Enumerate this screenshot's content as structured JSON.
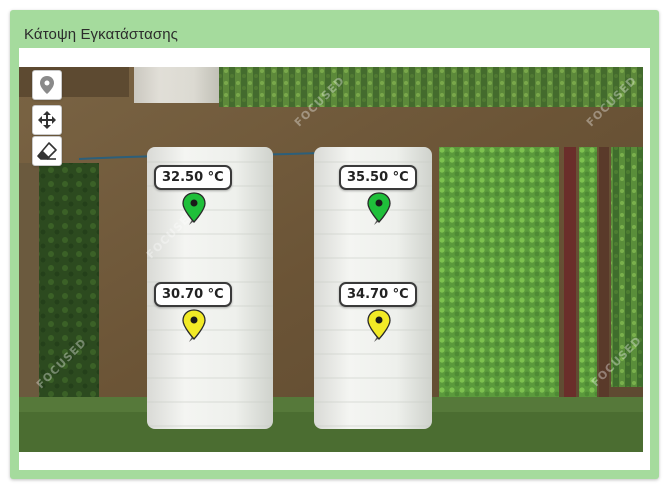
{
  "widget": {
    "title": "Κάτοψη Εγκατάστασης"
  },
  "controls": {
    "location": {
      "icon": "map-marker-icon"
    },
    "pan": {
      "icon": "move-arrows-icon"
    },
    "erase": {
      "icon": "eraser-icon"
    }
  },
  "markers": [
    {
      "label": "32.50 °C",
      "color": "#1fbf3a"
    },
    {
      "label": "35.50 °C",
      "color": "#1fbf3a"
    },
    {
      "label": "30.70 °C",
      "color": "#f2ea26"
    },
    {
      "label": "34.70 °C",
      "color": "#f2ea26"
    }
  ],
  "map": {
    "watermark": "FOCUSED"
  },
  "colors": {
    "widget_border": "#a5db9d",
    "marker_ok": "#1fbf3a",
    "marker_warn": "#f2ea26"
  }
}
